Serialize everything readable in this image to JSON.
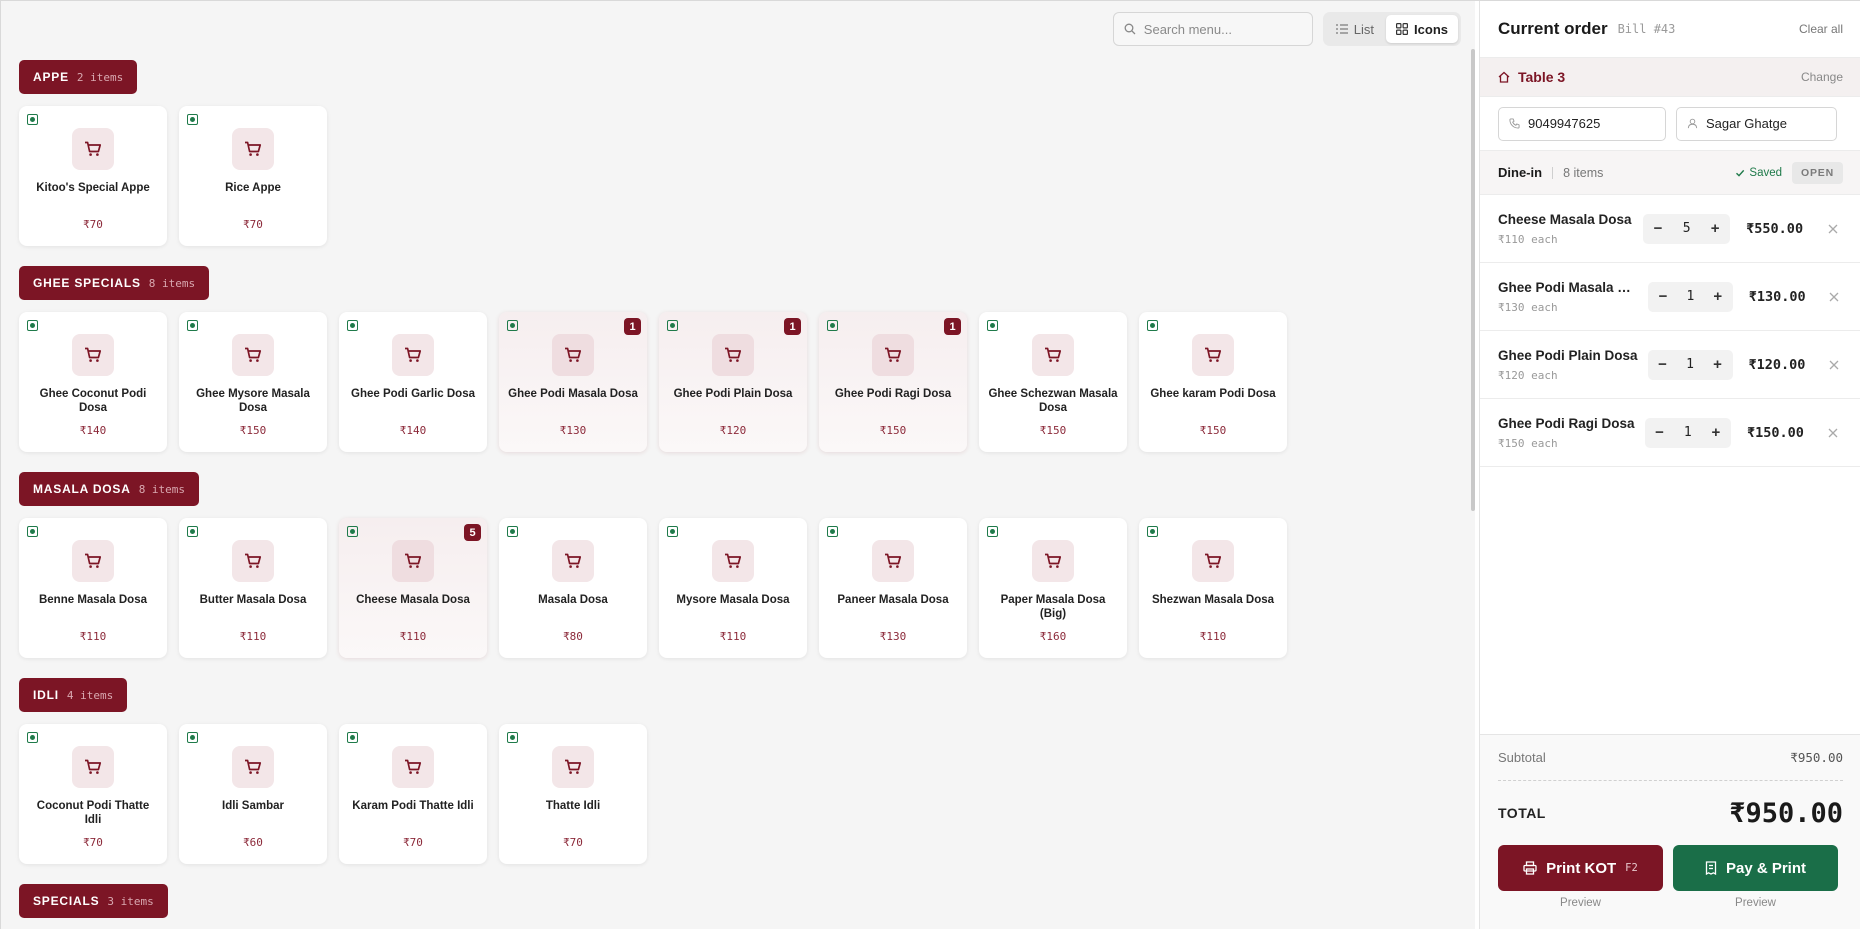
{
  "toolbar": {
    "search_placeholder": "Search menu...",
    "view_list_label": "List",
    "view_icons_label": "Icons"
  },
  "categories": [
    {
      "name": "APPE",
      "count": "2 items",
      "items": [
        {
          "name": "Kitoo's Special Appe",
          "price": "₹70"
        },
        {
          "name": "Rice Appe",
          "price": "₹70"
        }
      ]
    },
    {
      "name": "GHEE SPECIALS",
      "count": "8 items",
      "items": [
        {
          "name": "Ghee Coconut Podi Dosa",
          "price": "₹140"
        },
        {
          "name": "Ghee Mysore Masala Dosa",
          "price": "₹150"
        },
        {
          "name": "Ghee Podi Garlic Dosa",
          "price": "₹140"
        },
        {
          "name": "Ghee Podi Masala Dosa",
          "price": "₹130",
          "qty": "1"
        },
        {
          "name": "Ghee Podi Plain Dosa",
          "price": "₹120",
          "qty": "1"
        },
        {
          "name": "Ghee Podi Ragi Dosa",
          "price": "₹150",
          "qty": "1"
        },
        {
          "name": "Ghee Schezwan Masala Dosa",
          "price": "₹150"
        },
        {
          "name": "Ghee karam Podi Dosa",
          "price": "₹150"
        }
      ]
    },
    {
      "name": "MASALA DOSA",
      "count": "8 items",
      "items": [
        {
          "name": "Benne Masala Dosa",
          "price": "₹110"
        },
        {
          "name": "Butter Masala Dosa",
          "price": "₹110"
        },
        {
          "name": "Cheese Masala Dosa",
          "price": "₹110",
          "qty": "5"
        },
        {
          "name": "Masala Dosa",
          "price": "₹80"
        },
        {
          "name": "Mysore Masala Dosa",
          "price": "₹110"
        },
        {
          "name": "Paneer Masala Dosa",
          "price": "₹130"
        },
        {
          "name": "Paper Masala Dosa (Big)",
          "price": "₹160"
        },
        {
          "name": "Shezwan Masala Dosa",
          "price": "₹110"
        }
      ]
    },
    {
      "name": "IDLI",
      "count": "4 items",
      "items": [
        {
          "name": "Coconut Podi Thatte Idli",
          "price": "₹70"
        },
        {
          "name": "Idli Sambar",
          "price": "₹60"
        },
        {
          "name": "Karam Podi Thatte Idli",
          "price": "₹70"
        },
        {
          "name": "Thatte Idli",
          "price": "₹70"
        }
      ]
    },
    {
      "name": "SPECIALS",
      "count": "3 items",
      "items": []
    }
  ],
  "order": {
    "title": "Current order",
    "bill": "Bill #43",
    "clear_label": "Clear all",
    "table_name": "Table 3",
    "change_label": "Change",
    "phone_value": "9049947625",
    "customer_value": "Sagar Ghatge",
    "mode": "Dine-in",
    "item_count": "8 items",
    "saved_label": "Saved",
    "status_badge": "OPEN",
    "items": [
      {
        "name": "Cheese Masala Dosa",
        "each": "₹110 each",
        "qty": "5",
        "total": "₹550.00"
      },
      {
        "name": "Ghee Podi Masala Dosa",
        "each": "₹130 each",
        "qty": "1",
        "total": "₹130.00"
      },
      {
        "name": "Ghee Podi Plain Dosa",
        "each": "₹120 each",
        "qty": "1",
        "total": "₹120.00"
      },
      {
        "name": "Ghee Podi Ragi Dosa",
        "each": "₹150 each",
        "qty": "1",
        "total": "₹150.00"
      }
    ],
    "subtotal_label": "Subtotal",
    "subtotal_value": "₹950.00",
    "total_label": "TOTAL",
    "total_value": "₹950.00",
    "print_kot_label": "Print KOT",
    "print_kot_shortcut": "F2",
    "pay_print_label": "Pay & Print",
    "preview_label": "Preview"
  },
  "icons": {
    "search": "search-icon",
    "list": "list-icon",
    "grid": "grid-icon",
    "cart": "cart-icon",
    "veg": "veg-indicator-icon",
    "home": "home-icon",
    "phone": "phone-icon",
    "user": "user-icon",
    "check": "check-icon",
    "close": "close-icon",
    "printer": "printer-icon",
    "receipt": "receipt-icon"
  },
  "colors": {
    "brand": "#7c1525",
    "pay": "#1a6e48",
    "veg": "#1f7a4a"
  }
}
